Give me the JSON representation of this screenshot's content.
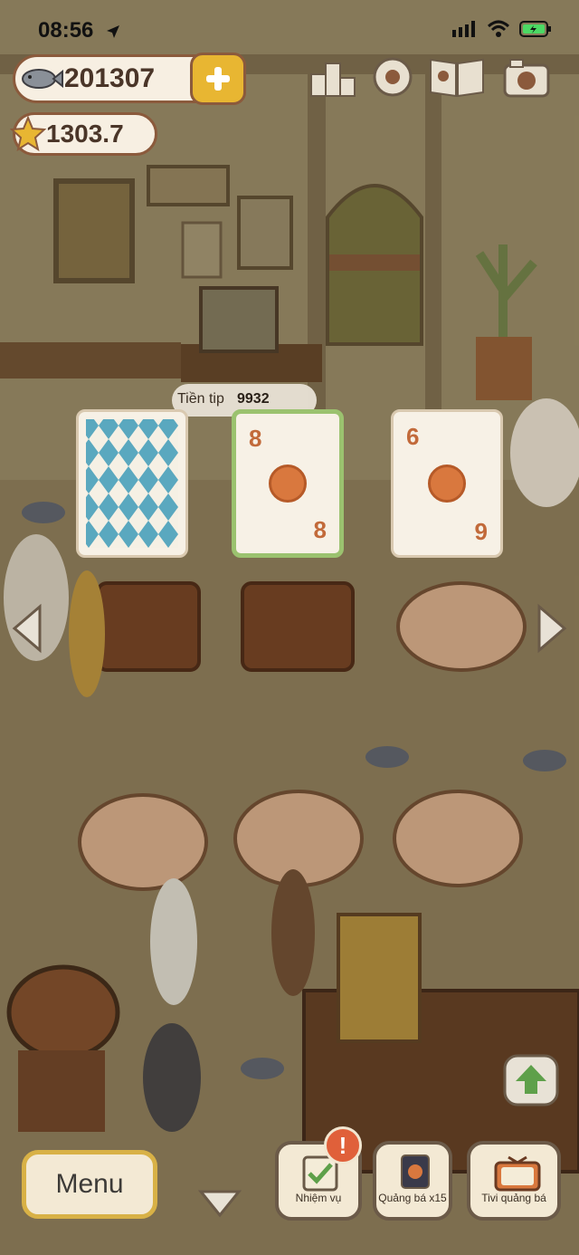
{
  "status_bar": {
    "time": "08:56"
  },
  "currency": {
    "fish": "201307",
    "stars": "1303.7"
  },
  "cards": {
    "tip_label": "Tiền tip",
    "tip_value": "9932",
    "card_2": {
      "top": "8",
      "bottom": "8"
    },
    "card_3": {
      "top": "6",
      "bottom": "9"
    }
  },
  "bottom_bar": {
    "menu_label": "Menu",
    "quests_label": "Nhiệm vụ",
    "quests_badge": "!",
    "promo_label": "Quảng bá x15",
    "tv_label": "Tivi quảng bá"
  },
  "icons": [
    "location-arrow-icon",
    "signal-icon",
    "wifi-icon",
    "battery-icon",
    "fish-icon",
    "plus-icon",
    "star-icon",
    "leaderboard-icon",
    "settings-gear-icon",
    "catalog-book-icon",
    "camera-icon",
    "arrow-left-icon",
    "arrow-right-icon",
    "arrow-down-icon",
    "arrow-up-icon",
    "checklist-icon",
    "promo-card-icon",
    "tv-icon"
  ],
  "colors": {
    "accent_gold": "#e8b632",
    "card_selected": "#9bc26f",
    "badge": "#e0603a",
    "coin": "#d9783e"
  }
}
